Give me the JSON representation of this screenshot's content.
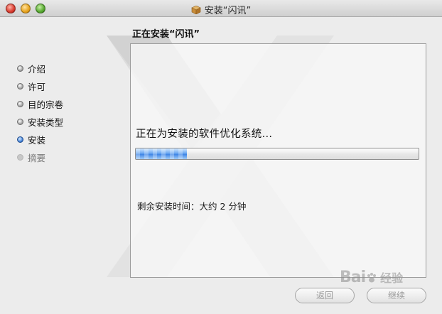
{
  "window": {
    "title": "安装“闪讯”",
    "icons": [
      "close-button",
      "minimize-button",
      "zoom-button",
      "package-icon"
    ]
  },
  "content_title": "正在安装“闪讯”",
  "steps": [
    {
      "label": "介绍",
      "state": "done"
    },
    {
      "label": "许可",
      "state": "done"
    },
    {
      "label": "目的宗卷",
      "state": "done"
    },
    {
      "label": "安装类型",
      "state": "done"
    },
    {
      "label": "安装",
      "state": "current"
    },
    {
      "label": "摘要",
      "state": "pending"
    }
  ],
  "status_text": "正在为安装的软件优化系统...",
  "progress": {
    "fraction": 0.18
  },
  "remaining_text": "剩余安装时间：大约 2 分钟",
  "buttons": {
    "back": "返回",
    "continue": "继续"
  },
  "watermark": {
    "brand": "Bai",
    "suffix": "经验"
  },
  "colors": {
    "progress_blue": "#3f86e6",
    "current_step": "#3f7fd6"
  }
}
